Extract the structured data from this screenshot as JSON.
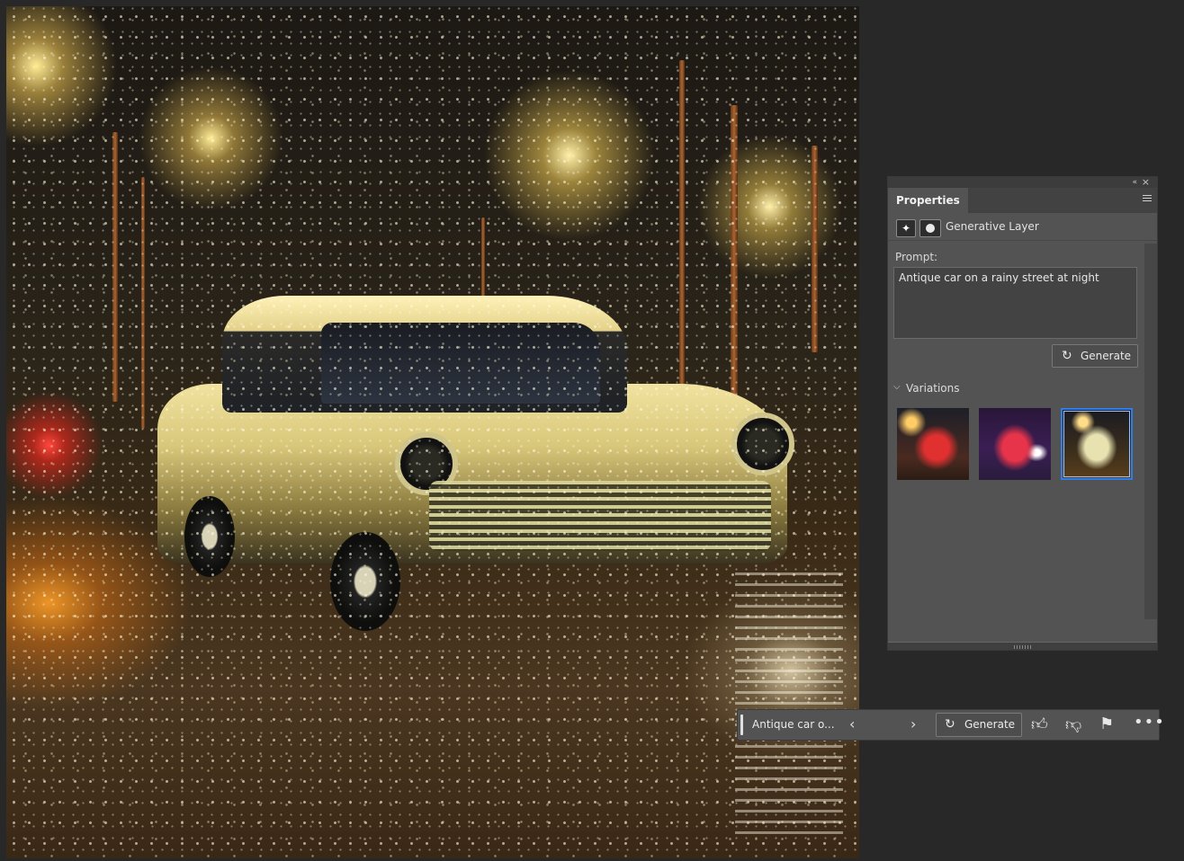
{
  "canvas": {
    "image_subject": ""
  },
  "panel": {
    "tab_label": "Properties",
    "collapse_glyph": "«",
    "close_glyph": "×",
    "layer_name": "Generative Layer",
    "prompt_label": "Prompt:",
    "prompt_text": "Antique car on a rainy street at night",
    "generate_label": "Generate",
    "variations_label": "Variations",
    "variation_selected_index": 3
  },
  "taskbar": {
    "prompt_short": "Antique car o...",
    "generate_label": "Generate",
    "prev_glyph": "‹",
    "next_glyph": "›"
  },
  "icons": {
    "generate": "generate-sparkle-icon",
    "thumbs_up": "thumbs-up-icon",
    "thumbs_down": "thumbs-down-icon",
    "flag": "flag-icon",
    "more": "more-icon"
  },
  "colors": {
    "selected_border": "#2f7ee8",
    "panel_bg": "#535353",
    "app_bg": "#282828"
  }
}
